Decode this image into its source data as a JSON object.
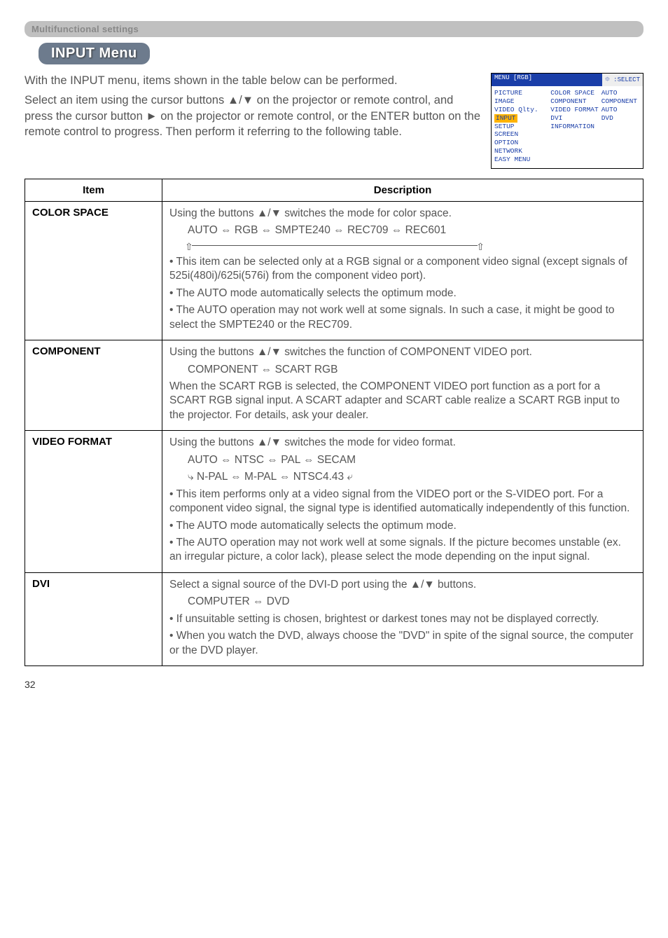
{
  "section_header": "Multifunctional settings",
  "menu_title": "INPUT Menu",
  "intro": {
    "p1": "With the INPUT menu, items shown in the table below can be performed.",
    "p2": "Select an item using the cursor buttons ▲/▼ on the projector or remote control, and press the cursor button ► on the projector or remote control, or the ENTER button on the remote control to progress. Then perform it referring to the following table."
  },
  "osd": {
    "top_left": "MENU [RGB]",
    "top_right": "⯐ :SELECT",
    "left_items": [
      "PICTURE",
      "IMAGE",
      "VIDEO Qlty.",
      "INPUT",
      "SETUP",
      "SCREEN",
      "OPTION",
      "NETWORK",
      "EASY MENU"
    ],
    "highlight_index": 3,
    "right_rows": [
      [
        "COLOR SPACE",
        "AUTO"
      ],
      [
        "COMPONENT",
        "COMPONENT"
      ],
      [
        "VIDEO FORMAT",
        "AUTO"
      ],
      [
        "DVI",
        "DVD"
      ],
      [
        "INFORMATION",
        ""
      ]
    ]
  },
  "table": {
    "head_item": "Item",
    "head_desc": "Description",
    "rows": [
      {
        "item": "COLOR SPACE",
        "p1": "Using the buttons ▲/▼ switches the mode for color space.",
        "opts": "AUTO ⇔ RGB ⇔ SMPTE240 ⇔ REC709 ⇔ REC601",
        "b1": "• This item can be selected only at a RGB signal or a component video signal (except signals of 525i(480i)/625i(576i) from the component video port).",
        "b2": "• The AUTO mode automatically selects the optimum mode.",
        "b3": "• The AUTO operation may not work well at some signals. In such a case, it might be good to select the SMPTE240 or the REC709."
      },
      {
        "item": "COMPONENT",
        "p1": "Using the buttons ▲/▼ switches the function of COMPONENT VIDEO port.",
        "opts": "COMPONENT ⇔ SCART RGB",
        "b1": "When the SCART RGB is selected, the COMPONENT VIDEO port function as a port for a SCART RGB signal input. A SCART adapter and SCART cable realize a SCART RGB input to the projector. For details, ask your dealer."
      },
      {
        "item": "VIDEO FORMAT",
        "p1": "Using the buttons ▲/▼ switches the mode for video format.",
        "opts1": "AUTO  ⇔  NTSC  ⇔  PAL  ⇔  SECAM",
        "opts2": "⤷ N-PAL ⇔ M-PAL ⇔ NTSC4.43 ⤶",
        "b1": "• This item performs only at a video signal from the VIDEO port or the S-VIDEO port. For a component video signal, the signal type is identified automatically independently of this function.",
        "b2": "• The AUTO mode automatically selects the optimum mode.",
        "b3": "• The AUTO operation may not work well at some signals. If the picture becomes unstable (ex. an irregular picture, a color lack), please select the mode depending on the input signal."
      },
      {
        "item": "DVI",
        "p1": "Select a signal source of the DVI-D port using the ▲/▼ buttons.",
        "opts": "COMPUTER ⇔ DVD",
        "b1": "• If unsuitable setting is chosen, brightest or darkest tones may not be displayed correctly.",
        "b2": "• When you watch the DVD, always choose the \"DVD\" in spite of the signal source, the computer or the DVD player."
      }
    ]
  },
  "page_number": "32"
}
